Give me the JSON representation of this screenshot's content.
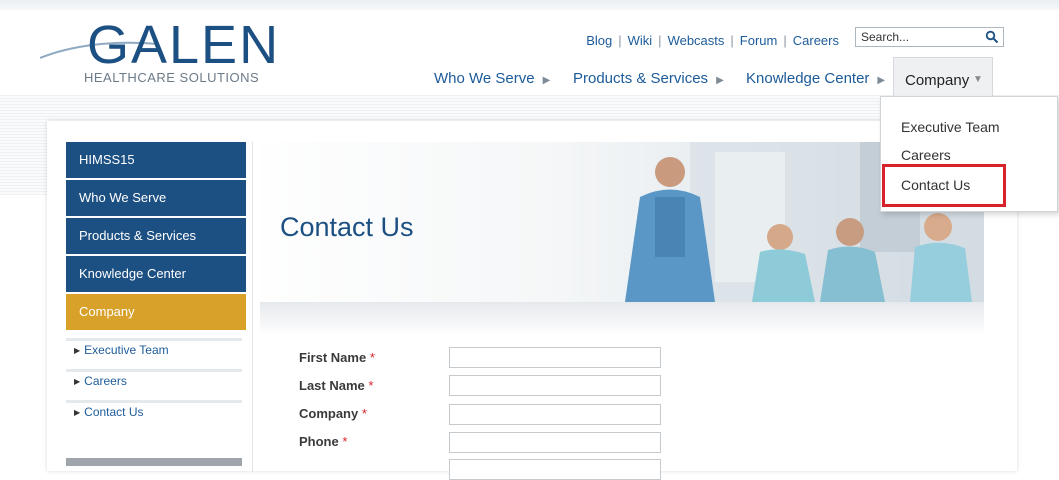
{
  "logo": {
    "word": "GALEN",
    "sub": "HEALTHCARE SOLUTIONS"
  },
  "util_links": [
    "Blog",
    "Wiki",
    "Webcasts",
    "Forum",
    "Careers"
  ],
  "search": {
    "placeholder": "Search..."
  },
  "main_nav": [
    "Who We Serve",
    "Products & Services",
    "Knowledge Center"
  ],
  "company_tab": "Company",
  "dropdown": [
    "Executive Team",
    "Careers",
    "Contact Us"
  ],
  "sidebar": {
    "items": [
      "HIMSS15",
      "Who We Serve",
      "Products & Services",
      "Knowledge Center",
      "Company"
    ],
    "sub_items": [
      "Executive Team",
      "Careers",
      "Contact Us"
    ]
  },
  "page_title": "Contact Us",
  "form": {
    "fields": [
      "First Name",
      "Last Name",
      "Company",
      "Phone"
    ],
    "required_mark": "*"
  },
  "colors": {
    "brand": "#1c4f82",
    "active": "#d8a12a",
    "highlight": "#d9232c"
  }
}
